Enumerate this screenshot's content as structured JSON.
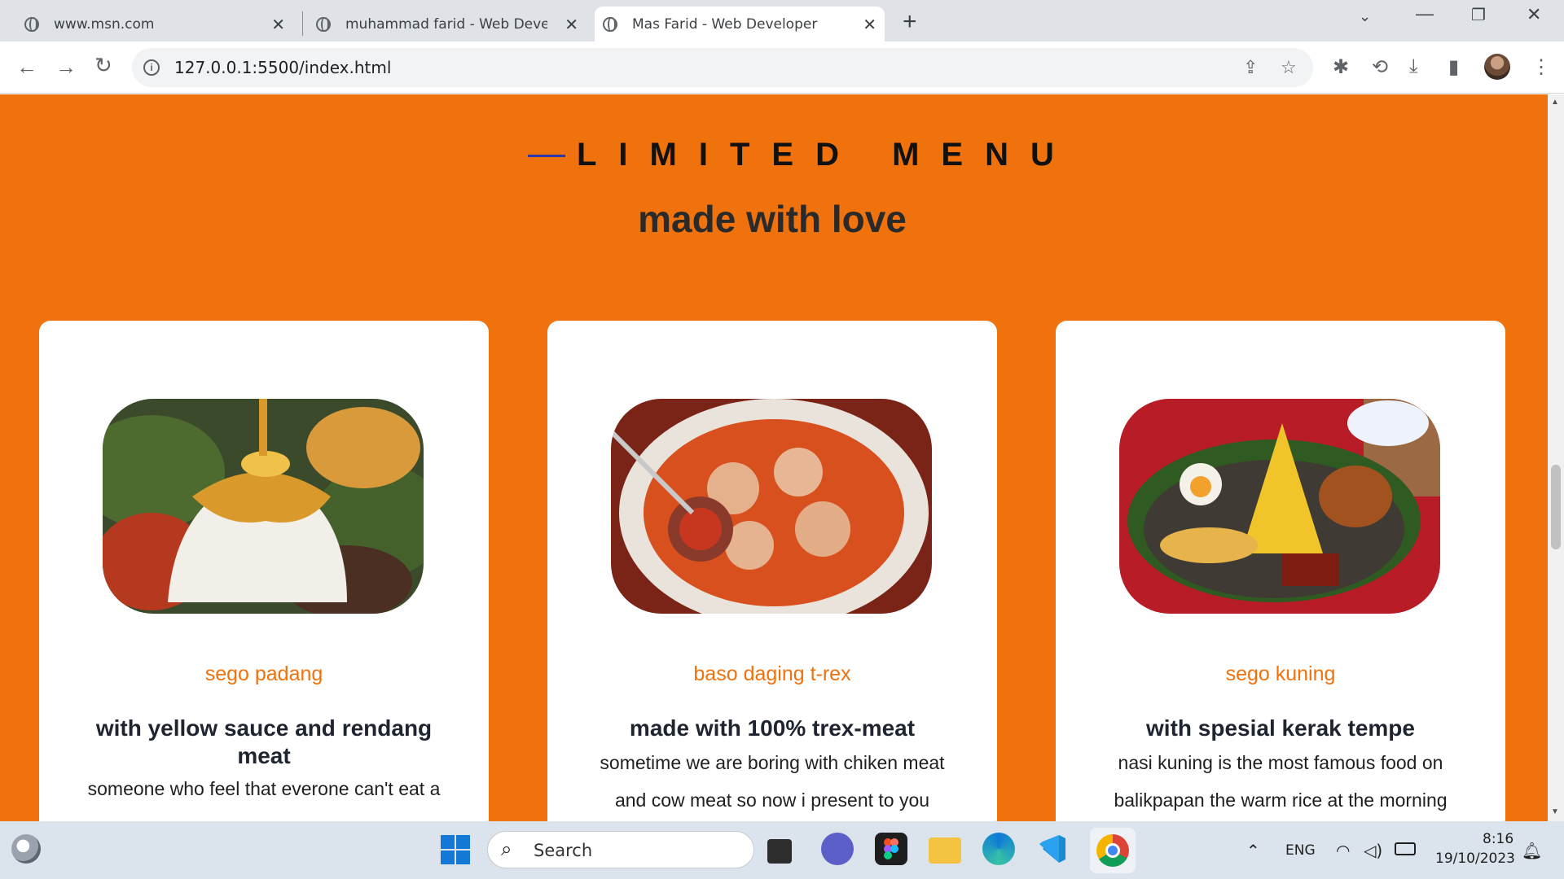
{
  "browser": {
    "tabs": [
      {
        "title": "www.msn.com",
        "active": false
      },
      {
        "title": "muhammad farid - Web Develop",
        "active": false
      },
      {
        "title": "Mas Farid - Web Developer",
        "active": true
      }
    ],
    "new_tab": "+",
    "close": "✕",
    "url": "127.0.0.1:5500/index.html"
  },
  "page": {
    "heading": "LIMITED MENU",
    "subheading": "made with love",
    "accent_color": "#ef720d",
    "cards": [
      {
        "name": "sego padang",
        "tagline": "with yellow sauce and rendang meat",
        "desc_lines": [
          "someone who feel that everone can't eat a"
        ]
      },
      {
        "name": "baso daging t-rex",
        "tagline": "made with 100% trex-meat",
        "desc_lines": [
          "sometime we are boring with chiken meat",
          "and cow meat so now i present to you"
        ]
      },
      {
        "name": "sego kuning",
        "tagline": "with spesial kerak tempe",
        "desc_lines": [
          "nasi kuning is the most famous food on",
          "balikpapan the warm rice at the morning"
        ]
      }
    ]
  },
  "taskbar": {
    "search_label": "Search",
    "language": "ENG",
    "time": "8:16",
    "date": "19/10/2023"
  }
}
